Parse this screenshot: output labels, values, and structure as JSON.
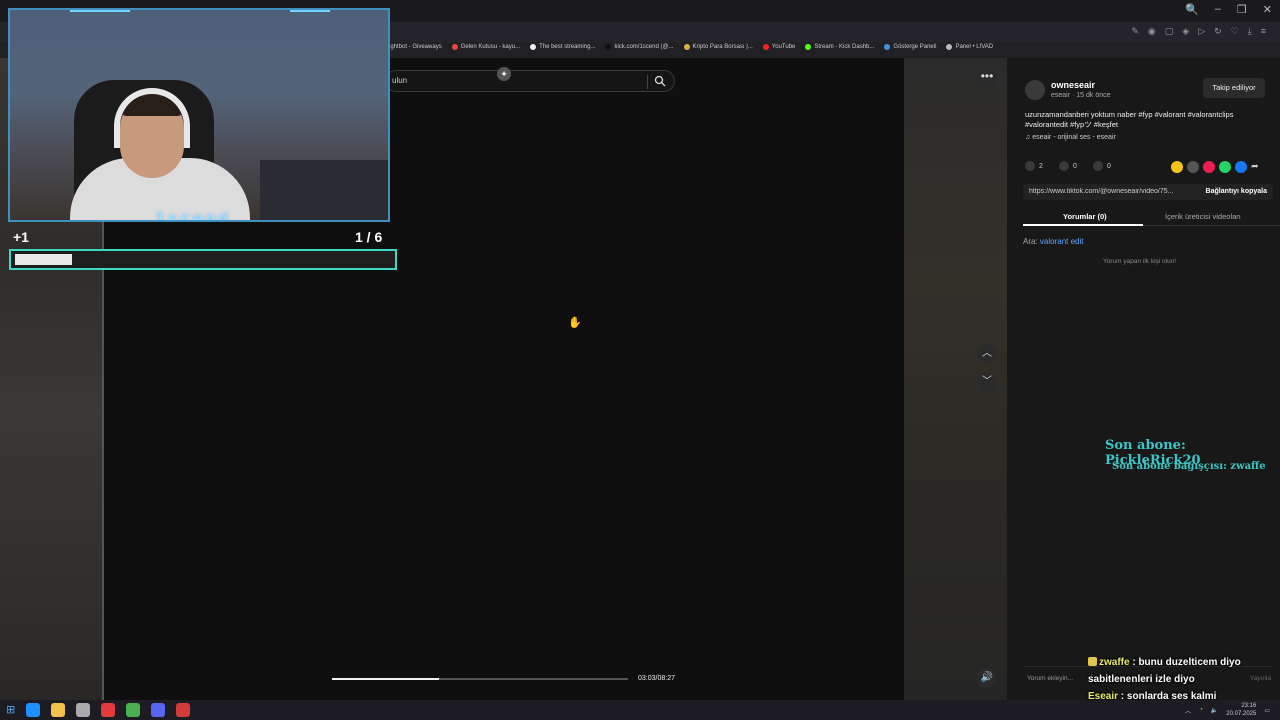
{
  "browser": {
    "window_controls": [
      "🔍",
      "–",
      "❐",
      "✕"
    ],
    "bookmarks": [
      {
        "label": "ightbot - Giveaways",
        "color": "#4aa3ff"
      },
      {
        "label": "Gelen Kutusu - kayu...",
        "color": "#e34b3a"
      },
      {
        "label": "The best streaming...",
        "color": "#eeeeee"
      },
      {
        "label": "kick.com/1scend (@...",
        "color": "#111111"
      },
      {
        "label": "Kripto Para Borsası |...",
        "color": "#e0b03c"
      },
      {
        "label": "YouTube",
        "color": "#ff2020"
      },
      {
        "label": "Stream - Kick Dashb...",
        "color": "#53fc18"
      },
      {
        "label": "Gösterge Paneli",
        "color": "#4a90e2"
      },
      {
        "label": "Panel • LIVAD",
        "color": "#bbbbbb"
      }
    ]
  },
  "video": {
    "search_placeholder": "ulun",
    "time": "03:03/08:27",
    "progress": 0.36
  },
  "post": {
    "author_name": "owneseair",
    "author_sub": "eseair · 15 dk önce",
    "follow_label": "Takip ediliyor",
    "caption": "uzunzamandanberi yoktum naber #fyp #valorant #valorantclips #valorantedit #fypツ #keşfet",
    "music": "♫  eseair - orijinal ses - eseair",
    "likes": "2",
    "comments": "0",
    "saves": "0",
    "link_url": "https://www.tiktok.com/@owneseair/video/75...",
    "copy_label": "Bağlantıyı kopyala",
    "tab_comments": "Yorumlar (0)",
    "tab_creator": "İçerik üreticisi videoları",
    "search_hint_prefix": "Ara: ",
    "search_hint_query": "valorant edit",
    "empty_comments": "Yorum yapan ilk kişi olun!",
    "comment_placeholder": "Yorum ekleyin...",
    "comment_post": "Yayınla",
    "share_colors": [
      "#f5c518",
      "#555555",
      "#ee1d52",
      "#25d366",
      "#1877f2"
    ]
  },
  "overlay": {
    "last_sub": "Son abone: PickleRick20",
    "last_gift": "Son abone bağışçısı: zwaffe",
    "cam_label": "1scend",
    "counter_left": "+1",
    "counter_right": "1  / 6",
    "goal_progress": 0.15,
    "chat": [
      {
        "user": "zwaffe",
        "msg": " : bunu duzelticem diyo"
      },
      {
        "user": "",
        "msg": "sabitlenenleri izle diyo"
      },
      {
        "user": "Eseair",
        "msg": " : sonlarda ses kalmi"
      }
    ]
  },
  "taskbar": {
    "time": "23:16",
    "date": "20.07.2025",
    "apps": [
      "#1e90ff",
      "#f2c14e",
      "#aaaaaa",
      "#e33b3b",
      "#4caf50",
      "#5865f2",
      "#d33c3c"
    ]
  }
}
